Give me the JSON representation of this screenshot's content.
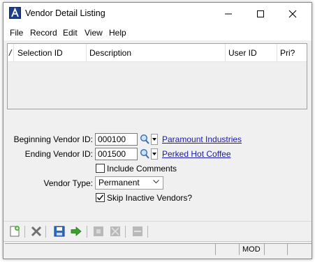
{
  "window": {
    "title": "Vendor Detail Listing",
    "controls": [
      "minimize-icon",
      "maximize-icon",
      "close-icon"
    ]
  },
  "menu": {
    "items": [
      "File",
      "Record",
      "Edit",
      "View",
      "Help"
    ]
  },
  "grid": {
    "columns": [
      "/",
      "Selection ID",
      "Description",
      "User ID",
      "Pri?"
    ],
    "rows": []
  },
  "form": {
    "beginning_vendor": {
      "label": "Beginning Vendor ID:",
      "value": "000100",
      "link": "Paramount Industries"
    },
    "ending_vendor": {
      "label": "Ending Vendor ID:",
      "value": "001500",
      "link": "Perked Hot Coffee"
    },
    "include_comments": {
      "label": "Include Comments",
      "checked": false
    },
    "vendor_type": {
      "label": "Vendor Type:",
      "value": "Permanent"
    },
    "skip_inactive": {
      "label": "Skip Inactive Vendors?",
      "checked": true
    }
  },
  "toolbar": {
    "icons": [
      "new-icon",
      "delete-icon",
      "save-icon",
      "proceed-icon",
      "disabled-icon",
      "disabled-expand-icon",
      "disabled-dash-icon"
    ]
  },
  "status": {
    "mode": "MOD"
  },
  "colors": {
    "link": "#1a1aa6",
    "accent": "#1b3f8f",
    "window_bg": "#f0f0f0"
  }
}
